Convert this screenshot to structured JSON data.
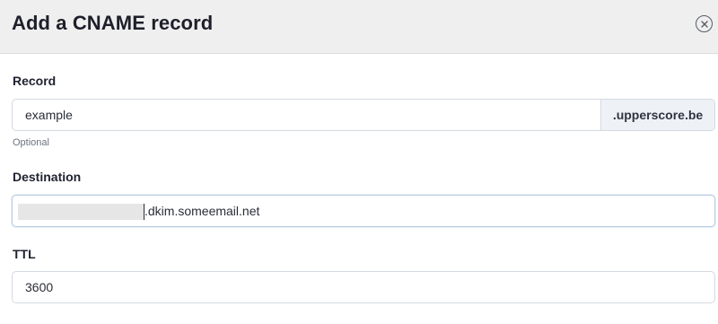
{
  "dialog": {
    "title": "Add a CNAME record",
    "close_icon": "close-circle-icon"
  },
  "record": {
    "label": "Record",
    "value": "example",
    "suffix": ".upperscore.be",
    "hint": "Optional"
  },
  "destination": {
    "label": "Destination",
    "value_visible": ".dkim.someemail.net"
  },
  "ttl": {
    "label": "TTL",
    "value": "3600"
  }
}
